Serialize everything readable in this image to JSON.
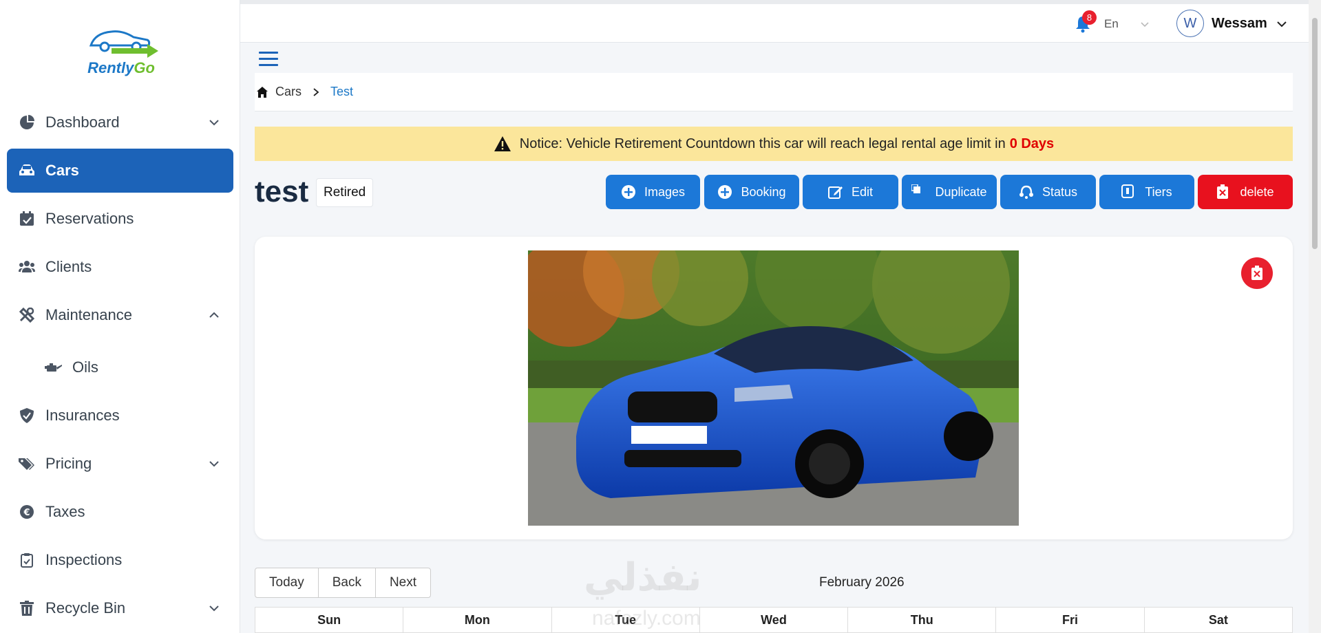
{
  "app": {
    "logo_word_1": "Rently",
    "logo_word_2": "Go"
  },
  "sidebar": {
    "items": [
      {
        "label": "Dashboard",
        "icon": "pie-chart-icon"
      },
      {
        "label": "Cars",
        "icon": "car-icon"
      },
      {
        "label": "Reservations",
        "icon": "calendar-check-icon"
      },
      {
        "label": "Clients",
        "icon": "users-icon"
      },
      {
        "label": "Maintenance",
        "icon": "tools-icon"
      },
      {
        "label": "Oils",
        "icon": "oil-can-icon"
      },
      {
        "label": "Insurances",
        "icon": "shield-check-icon"
      },
      {
        "label": "Pricing",
        "icon": "tags-icon"
      },
      {
        "label": "Taxes",
        "icon": "euro-icon"
      },
      {
        "label": "Inspections",
        "icon": "clipboard-check-icon"
      },
      {
        "label": "Recycle Bin",
        "icon": "trash-icon"
      }
    ]
  },
  "topbar": {
    "notification_count": "8",
    "language": "En",
    "avatar_initial": "W",
    "user_name": "Wessam"
  },
  "breadcrumb": {
    "parent": "Cars",
    "current": "Test"
  },
  "notice": {
    "text": "Notice: Vehicle Retirement Countdown this car will reach legal rental age limit in",
    "days": "0 Days"
  },
  "car": {
    "title": "test",
    "status": "Retired"
  },
  "actions": {
    "images": "Images",
    "booking": "Booking",
    "edit": "Edit",
    "duplicate": "Duplicate",
    "status": "Status",
    "tiers": "Tiers",
    "delete": "delete"
  },
  "calendar": {
    "today": "Today",
    "back": "Back",
    "next": "Next",
    "month": "February 2026",
    "days": [
      "Sun",
      "Mon",
      "Tue",
      "Wed",
      "Thu",
      "Fri",
      "Sat"
    ]
  },
  "watermark": {
    "arabic": "نفذلي",
    "site": "nafezly.com"
  },
  "colors": {
    "primary": "#1c63b8",
    "button": "#1c78d8",
    "danger": "#e8111e",
    "notice_bg": "#fbe69b"
  }
}
